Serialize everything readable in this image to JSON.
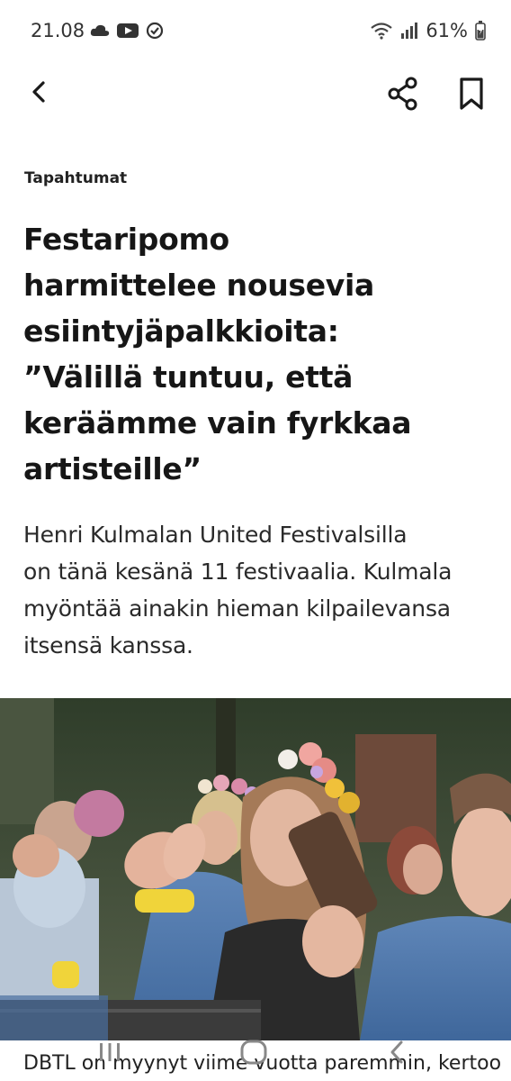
{
  "status_bar": {
    "time": "21.08",
    "battery": "61%",
    "icons_left": [
      "cloud-icon",
      "youtube-icon",
      "check-circle-icon"
    ],
    "icons_right": [
      "wifi-icon",
      "signal-icon",
      "battery-icon"
    ]
  },
  "app_bar": {
    "back": "back-icon",
    "share": "share-icon",
    "bookmark": "bookmark-icon"
  },
  "article": {
    "category": "Tapahtumat",
    "headline_lines": [
      "Festaripomo",
      "harmittelee nousevia",
      "esiintyjäpalkkioita:",
      "”Välillä tuntuu, että",
      "keräämme vain fyrkkaa",
      "artisteille”"
    ],
    "lead_lines": [
      "Henri Kulmalan United Festivalsilla",
      "on tänä kesänä 11 festivaalia. Kulmala",
      "myöntää ainakin hieman kilpailevansa",
      "itsensä kanssa."
    ],
    "caption_peek": "DBTL on myynyt viime vuotta paremmin, kertoo"
  },
  "nav_bar": {
    "recents": "recents-icon",
    "home": "home-icon",
    "back": "nav-back-icon"
  }
}
